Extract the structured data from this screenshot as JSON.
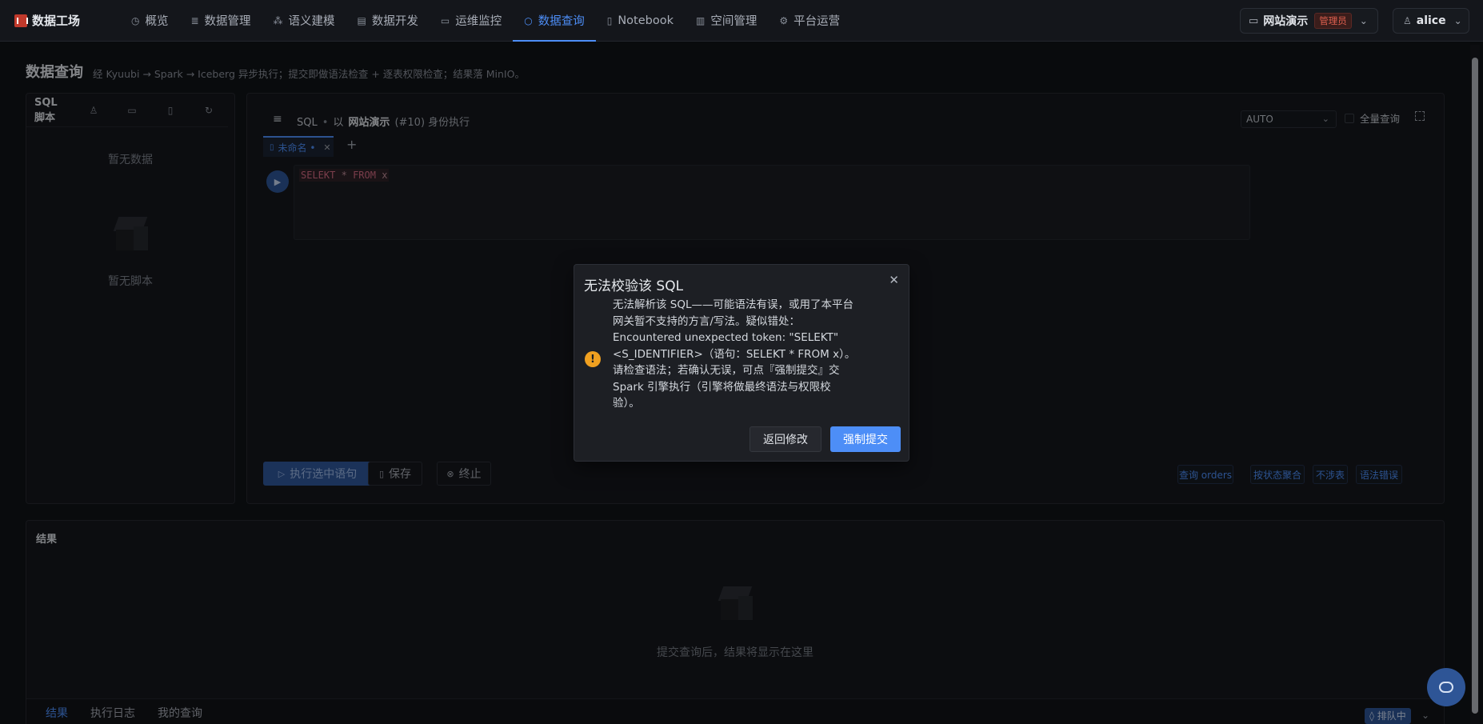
{
  "brand": {
    "name": "数据工场"
  },
  "nav": [
    {
      "label": "概览",
      "icon": "dashboard-icon",
      "glyph": "◷"
    },
    {
      "label": "数据管理",
      "icon": "database-icon",
      "glyph": "≣"
    },
    {
      "label": "语义建模",
      "icon": "model-icon",
      "glyph": "⁂"
    },
    {
      "label": "数据开发",
      "icon": "dev-icon",
      "glyph": "▤"
    },
    {
      "label": "运维监控",
      "icon": "monitor-icon",
      "glyph": "▭"
    },
    {
      "label": "数据查询",
      "icon": "search-icon",
      "glyph": "○",
      "active": true
    },
    {
      "label": "Notebook",
      "icon": "notebook-icon",
      "glyph": "▯"
    },
    {
      "label": "空间管理",
      "icon": "space-icon",
      "glyph": "▥"
    },
    {
      "label": "平台运营",
      "icon": "settings-icon",
      "glyph": "⚙"
    }
  ],
  "workspace": {
    "name": "网站演示",
    "role": "管理员"
  },
  "user": {
    "name": "alice"
  },
  "page": {
    "title": "数据查询",
    "description": "经 Kyuubi → Spark → Iceberg 异步执行；提交即做语法检查 + 逐表权限检查；结果落 MinIO。"
  },
  "scripts_panel": {
    "title": "SQL 脚本",
    "empty_text": "暂无数据",
    "empty_scripts": "暂无脚本"
  },
  "editor": {
    "header_prefix": "SQL",
    "as_label": "以",
    "workspace": "网站演示",
    "identity": "(#10) 身份执行",
    "mode": "AUTO",
    "full_query_label": "全量查询",
    "tab_name": "未命名 •",
    "code": {
      "kw1": "SELEKT",
      "star": "*",
      "kw2": "FROM",
      "table": "x"
    },
    "run_button": "执行选中语句",
    "save_button": "保存",
    "stop_button": "终止",
    "samples": [
      "查询 orders",
      "按状态聚合",
      "不涉表",
      "语法错误"
    ]
  },
  "results": {
    "title": "结果",
    "empty_text": "提交查询后，结果将显示在这里",
    "tabs": [
      "结果",
      "执行日志",
      "我的查询"
    ],
    "queue_status": "◊ 排队中"
  },
  "dialog": {
    "title": "无法校验该 SQL",
    "message": "无法解析该 SQL——可能语法有误，或用了本平台网关暂不支持的方言/写法。疑似错处：Encountered unexpected token: \"SELEKT\" <S_IDENTIFIER>（语句：SELEKT * FROM x）。请检查语法；若确认无误，可点『强制提交』交 Spark 引擎执行（引擎将做最终语法与权限校验）。",
    "back_button": "返回修改",
    "force_button": "强制提交"
  },
  "colors": {
    "accent": "#4d8ef7",
    "background": "#111317",
    "warning": "#f0a020",
    "role_badge": "#e0604f"
  }
}
